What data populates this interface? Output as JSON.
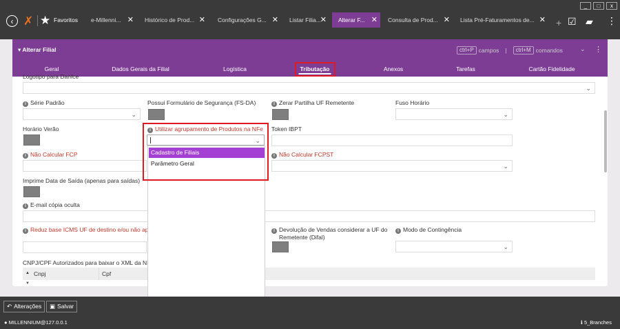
{
  "topbar": {
    "favorites": "Favoritos",
    "tabs": [
      {
        "label": "e-Millenni..."
      },
      {
        "label": "Histórico de Prod..."
      },
      {
        "label": "Configurações G..."
      },
      {
        "label": "Listar Filia..."
      },
      {
        "label": "Alterar F..."
      },
      {
        "label": "Consulta de Prod..."
      },
      {
        "label": "Lista Pré-Faturamentos de..."
      }
    ],
    "close_glyph": "✕",
    "window_controls": [
      "_",
      "□",
      "x"
    ]
  },
  "panel": {
    "title": "Alterar Filial",
    "shortcut_campos_key": "ctrl+P",
    "shortcut_campos_label": "campos",
    "shortcut_sep": "|",
    "shortcut_comandos_key": "ctrl+M",
    "shortcut_comandos_label": "comandos",
    "tabs": [
      "Geral",
      "Dados Gerais da Filial",
      "Logística",
      "Tributação",
      "Anexos",
      "Tarefas",
      "Cartão Fidelidade"
    ],
    "active_tab": "Tributação"
  },
  "form": {
    "logotipo_label": "Logotipo para Danfce",
    "serie_padrao": "Série Padrão",
    "possui_formulario": "Possui Formulário de Segurança (FS-DA)",
    "zerar_partilha": "Zerar Partilha UF Remetente",
    "fuso_horario": "Fuso Horário",
    "horario_verao": "Horário Verão",
    "utilizar_agrupamento": "Utilizar agrupamento de Produtos na NFe",
    "token_ibpt": "Token IBPT",
    "nao_calcular_fcp": "Não Calcular FCP",
    "nao_calcular_fcpst": "Não Calcular FCPST",
    "imprime_data_saida": "Imprime Data de Saída (apenas para saídas)",
    "email_copia": "E-mail cópia oculta",
    "reduz_base": "Reduz base ICMS UF de destino e/ou não apli",
    "devolucao_l1": "Devolução de Vendas considerar a UF do",
    "devolucao_l2": "Remetente (Difal)",
    "modo_contingencia": "Modo de Contingência",
    "cnpj_autorizados": "CNPJ/CPF Autorizados para baixar o XML da NFe",
    "table_headers": [
      "Cnpj",
      "Cpf"
    ]
  },
  "dropdown": {
    "options": [
      "Cadastro de Filiais",
      "Parâmetro Geral"
    ],
    "selected": "Cadastro de Filiais"
  },
  "bottombar": {
    "alteracoes": "Alterações",
    "salvar": "Salvar",
    "user": "MILLENNIUM@127.0.0.1",
    "branch": "5_Branches"
  }
}
